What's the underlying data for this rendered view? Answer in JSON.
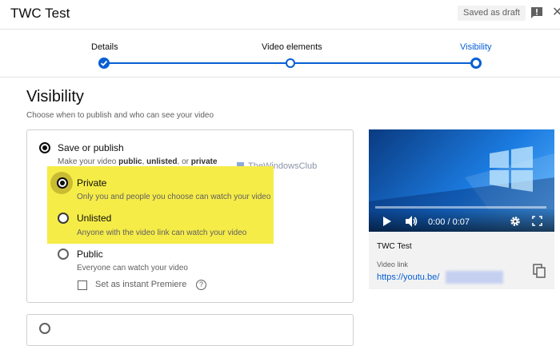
{
  "header": {
    "title": "TWC Test",
    "draft_badge": "Saved as draft",
    "feedback_icon": "feedback-icon",
    "close_icon": "close-icon"
  },
  "stepper": {
    "steps": [
      {
        "label": "Details",
        "state": "done"
      },
      {
        "label": "Video elements",
        "state": "current"
      },
      {
        "label": "Visibility",
        "state": "current"
      }
    ],
    "accent_color": "#065fd4"
  },
  "page": {
    "heading": "Visibility",
    "subheading": "Choose when to publish and who can see your video"
  },
  "save_or_publish": {
    "label": "Save or publish",
    "desc_pre": "Make your video ",
    "desc_public": "public",
    "desc_sep": ", ",
    "desc_unlisted": "unlisted",
    "desc_or": ", or ",
    "desc_private": "private",
    "options": [
      {
        "label": "Private",
        "desc": "Only you and people you choose can watch your video",
        "selected": true
      },
      {
        "label": "Unlisted",
        "desc": "Anyone with the video link can watch your video",
        "selected": false
      },
      {
        "label": "Public",
        "desc": "Everyone can watch your video",
        "selected": false
      }
    ],
    "premiere_label": "Set as instant Premiere"
  },
  "watermark": "TheWindowsClub",
  "video": {
    "time": "0:00 / 0:07",
    "title": "TWC Test",
    "link_label": "Video link",
    "link": "https://youtu.be/"
  }
}
